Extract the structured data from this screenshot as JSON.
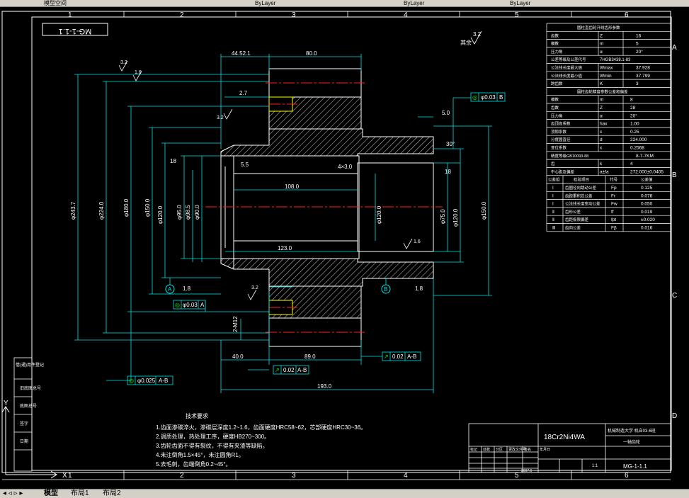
{
  "topbar": {
    "seg1": "模型空间",
    "seg2": "ByLayer",
    "seg3": "ByLayer",
    "seg4": "ByLayer"
  },
  "frame": {
    "cols_top": [
      "1",
      "2",
      "3",
      "4",
      "5",
      "6"
    ],
    "cols_bottom": [
      "1",
      "2",
      "3",
      "4",
      "5",
      "6"
    ],
    "rows_right": [
      "A",
      "B",
      "C",
      "D"
    ],
    "drawing_no_box": "MG-1-1.1"
  },
  "roughness": {
    "general": "3.2",
    "general_suffix": "其余",
    "r1": "3.2",
    "r2": "1.6",
    "r3": "3.2",
    "r4": "1.6",
    "r5": "3.2"
  },
  "dims": {
    "d_44_52": "44.52.1",
    "d_80": "80.0",
    "d_2_7": "2.7",
    "d_5_0": "5.0",
    "d_5_5": "5.5",
    "d_30deg": "30°",
    "d_108": "108.0",
    "d_123": "123.0",
    "d_43": "4×3.0",
    "d_40": "40.0",
    "d_89": "89.0",
    "d_193": "193.0",
    "d_2m12": "2-M12",
    "d_phi243": "φ243.7",
    "d_phi224": "φ224.0",
    "d_phi180": "φ180.0",
    "d_phi150a": "φ150.0",
    "d_phi120_a": "φ120.0",
    "d_phi95": "φ95.0",
    "d_phi98": "φ98.5",
    "d_phi90": "φ90.0",
    "d_phi120_b": "φ120.0",
    "d_phi75": "φ75.0",
    "d_phi120_c": "φ120.0",
    "d_phi150b": "φ150.0",
    "d_18a": "18",
    "d_18b": "18",
    "d_datum_a": "A",
    "d_datum_b": "B",
    "val_1_8": "1.8",
    "val_1_8b": "1.8"
  },
  "gdt": {
    "g1_val": "φ0.03",
    "g1_ref": "B",
    "g2_val": "φ0.03",
    "g2_ref": "A",
    "g3_val": "0.02",
    "g3_ref": "A-B",
    "g4_val": "0.02",
    "g4_ref": "A-B",
    "g5_val": "φ0.025",
    "g5_ref": "A-B"
  },
  "table": {
    "t1_title": "圆柱直齿轮开线齿形参数",
    "t1": [
      [
        "齿数",
        "Z",
        "16"
      ],
      [
        "模数",
        "m",
        "5"
      ],
      [
        "压力角",
        "α",
        "20°"
      ],
      [
        "公差等级及公差代号",
        "7HGB3438.1-83"
      ],
      [
        "公法线长度最大值",
        "Wmax",
        "37.928"
      ],
      [
        "公法线长度最小值",
        "Wmin",
        "37.799"
      ],
      [
        "跨齿数",
        "K",
        "3"
      ]
    ],
    "t2_title": "圆柱齿轮精度参数公差和偏差",
    "t2": [
      [
        "模数",
        "m",
        "8"
      ],
      [
        "齿数",
        "Z",
        "28"
      ],
      [
        "压力角",
        "α",
        "20°"
      ],
      [
        "齿顶高系数",
        "hax",
        "1.00"
      ],
      [
        "顶隙系数",
        "c",
        "0.25"
      ],
      [
        "分度圆直径",
        "d",
        "224.000"
      ],
      [
        "变位系数",
        "x",
        "0.2568"
      ],
      [
        "精度等级GB10093-88",
        "8-7-7KM"
      ],
      [
        "齿",
        "k",
        "4"
      ],
      [
        "中心距及偏差",
        "a±fa",
        "272.000±0.0405"
      ]
    ],
    "t3_head": [
      "公差组",
      "检验项目",
      "代号",
      "公差值"
    ],
    "t3": [
      [
        "Ⅰ",
        "齿圈径向跳动公差",
        "Fp",
        "0.125"
      ],
      [
        "Ⅰ",
        "齿距累积总公差",
        "Fr",
        "0.076"
      ],
      [
        "Ⅰ",
        "公法线长度变动公差",
        "Fw",
        "0.050"
      ],
      [
        "Ⅱ",
        "齿形公差",
        "ff",
        "0.019"
      ],
      [
        "Ⅱ",
        "齿距极限偏差",
        "fpt",
        "±0.020"
      ],
      [
        "Ⅲ",
        "齿向公差",
        "Fβ",
        "0.016"
      ]
    ]
  },
  "notes": {
    "title": "技术要求",
    "lines": [
      "1.齿面渗碳淬火，渗碳层深度1.2~1.6，齿面硬度HRC58~62，芯部硬度HRC30~36。",
      "2.调质处理，热处理工序，硬度HB270~300。",
      "3.齿轮齿面不得有裂纹，不得有夹渣等缺陷。",
      "4.未注倒角1.5×45°，未注圆角R1。",
      "5.去毛刺，齿端倒角0.2~45°。"
    ]
  },
  "titleblock": {
    "material": "18Cr2Ni4WA",
    "company": "机械制造大学  机自03-6班",
    "part_name": "一轴齿轮",
    "drawing_no": "MG-1-1.1",
    "scale": "1:1",
    "date": "2007.6",
    "h1": "标记",
    "h2": "处数",
    "h3": "分区",
    "h4": "更改文件号",
    "h5": "签名",
    "h6": "年月日"
  },
  "left_strip": [
    "借(通)用件登记",
    "旧底图总号",
    "底图总号",
    "签字",
    "日期"
  ],
  "ucs": {
    "y": "Y",
    "x": "X"
  },
  "tabs": {
    "model": "模型",
    "layout1": "布局1",
    "layout2": "布局2"
  },
  "colors": {
    "line": "#ffffff",
    "cyan": "#00e5e5",
    "red": "#ff2020",
    "yellow": "#ffff00",
    "green": "#00ff00",
    "blue": "#4c8cff"
  }
}
